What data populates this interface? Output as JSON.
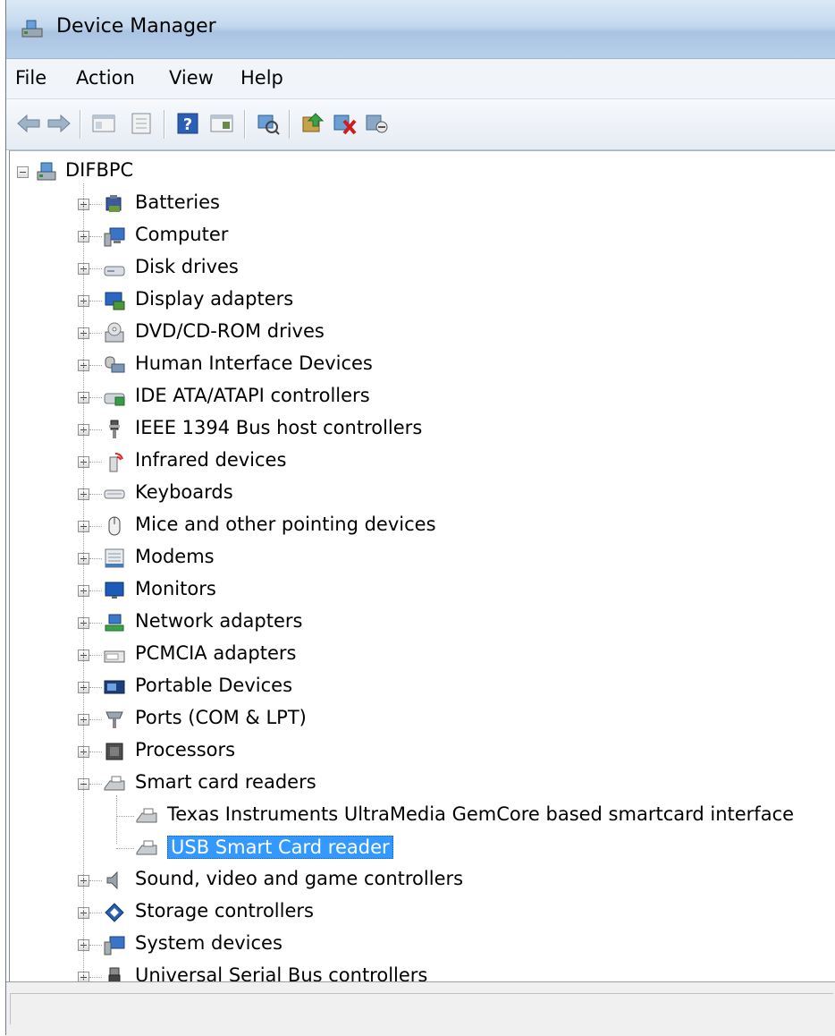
{
  "window": {
    "title": "Device Manager"
  },
  "menu": {
    "file": "File",
    "action": "Action",
    "view": "View",
    "help": "Help"
  },
  "toolbar": {
    "buttons": [
      "back-icon",
      "forward-icon",
      "tree-view-icon",
      "properties-icon",
      "help-icon",
      "details-view-icon",
      "scan-hardware-icon",
      "update-driver-icon",
      "uninstall-icon",
      "disable-icon"
    ]
  },
  "tree": {
    "root": "DIFBPC",
    "categories": [
      {
        "label": "Batteries",
        "icon": "battery-icon"
      },
      {
        "label": "Computer",
        "icon": "computer-icon"
      },
      {
        "label": "Disk drives",
        "icon": "disk-drive-icon"
      },
      {
        "label": "Display adapters",
        "icon": "display-adapter-icon"
      },
      {
        "label": "DVD/CD-ROM drives",
        "icon": "dvd-drive-icon"
      },
      {
        "label": "Human Interface Devices",
        "icon": "hid-icon"
      },
      {
        "label": "IDE ATA/ATAPI controllers",
        "icon": "ide-controller-icon"
      },
      {
        "label": "IEEE 1394 Bus host controllers",
        "icon": "ieee1394-icon"
      },
      {
        "label": "Infrared devices",
        "icon": "infrared-icon"
      },
      {
        "label": "Keyboards",
        "icon": "keyboard-icon"
      },
      {
        "label": "Mice and other pointing devices",
        "icon": "mouse-icon"
      },
      {
        "label": "Modems",
        "icon": "modem-icon"
      },
      {
        "label": "Monitors",
        "icon": "monitor-icon"
      },
      {
        "label": "Network adapters",
        "icon": "network-adapter-icon"
      },
      {
        "label": "PCMCIA adapters",
        "icon": "pcmcia-icon"
      },
      {
        "label": "Portable Devices",
        "icon": "portable-device-icon"
      },
      {
        "label": "Ports (COM & LPT)",
        "icon": "port-icon"
      },
      {
        "label": "Processors",
        "icon": "processor-icon"
      },
      {
        "label": "Smart card readers",
        "icon": "smart-card-reader-icon"
      }
    ],
    "smart_card_children": [
      "Texas Instruments UltraMedia GemCore based smartcard interface",
      "USB Smart Card reader"
    ],
    "categories_after": [
      {
        "label": "Sound, video and game controllers",
        "icon": "sound-icon"
      },
      {
        "label": "Storage controllers",
        "icon": "storage-controller-icon"
      },
      {
        "label": "System devices",
        "icon": "system-device-icon"
      },
      {
        "label": "Universal Serial Bus controllers",
        "icon": "usb-icon"
      }
    ]
  },
  "colors": {
    "selection": "#3399ff",
    "title_bar": "#c3d8ee"
  }
}
